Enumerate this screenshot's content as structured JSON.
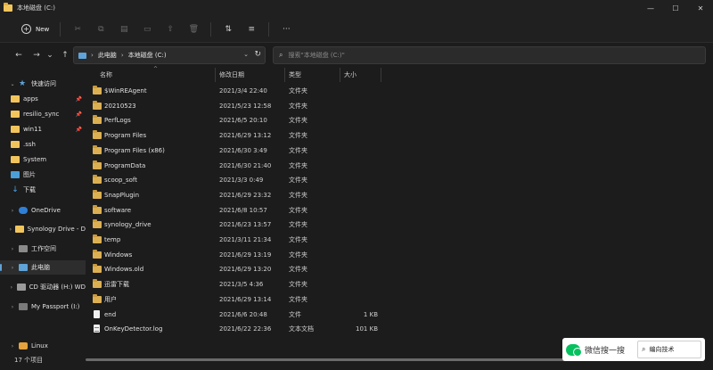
{
  "window": {
    "title": "本地磁盘 (C:)",
    "controls": {
      "minimize": "—",
      "maximize": "☐",
      "close": "✕"
    }
  },
  "toolbar": {
    "new_label": "New",
    "new_icon": "+",
    "icons": [
      {
        "name": "cut-icon",
        "glyph": "✂"
      },
      {
        "name": "copy-icon",
        "glyph": "⧉"
      },
      {
        "name": "paste-icon",
        "glyph": "▤"
      },
      {
        "name": "rename-icon",
        "glyph": "▭"
      },
      {
        "name": "share-icon",
        "glyph": "⇧"
      },
      {
        "name": "delete-icon",
        "glyph": "🗑"
      }
    ],
    "sort_glyph": "⇅",
    "view_glyph": "≡",
    "more_glyph": "···"
  },
  "nav": {
    "back": "←",
    "forward": "→",
    "recent": "⌄",
    "up": "↑"
  },
  "address": {
    "crumbs": [
      "此电脑",
      "本地磁盘 (C:)"
    ],
    "sep": "›",
    "dropdown": "⌄",
    "refresh": "↻"
  },
  "search": {
    "placeholder": "搜索\"本地磁盘 (C:)\"",
    "icon": "⌕"
  },
  "sidebar": {
    "items": [
      {
        "label": "快速访问",
        "icon": "star",
        "arrow": "⌄",
        "indent": false
      },
      {
        "label": "apps",
        "icon": "folder",
        "indent": true,
        "pin": "📌"
      },
      {
        "label": "resilio_sync",
        "icon": "folder",
        "indent": true,
        "pin": "📌"
      },
      {
        "label": "win11",
        "icon": "folder",
        "indent": true,
        "pin": "📌"
      },
      {
        "label": ".ssh",
        "icon": "folder",
        "indent": true
      },
      {
        "label": "System",
        "icon": "folder",
        "indent": true
      },
      {
        "label": "图片",
        "icon": "pic",
        "indent": true
      },
      {
        "label": "下载",
        "icon": "down",
        "indent": true
      },
      {
        "label": "OneDrive",
        "icon": "cloud",
        "arrow": "›",
        "indent": false
      },
      {
        "label": "Synology Drive - D",
        "icon": "syn",
        "arrow": "›",
        "indent": false
      },
      {
        "label": "工作空间",
        "icon": "desk",
        "arrow": "›",
        "indent": false
      },
      {
        "label": "此电脑",
        "icon": "pc",
        "arrow": "›",
        "indent": false,
        "selected": true
      },
      {
        "label": "CD 驱动器 (H:) WD",
        "icon": "cd",
        "arrow": "›",
        "indent": false
      },
      {
        "label": "My Passport (I:)",
        "icon": "drive",
        "arrow": "›",
        "indent": false
      },
      {
        "label": "Linux",
        "icon": "linux",
        "arrow": "›",
        "indent": false
      }
    ]
  },
  "columns": {
    "name": "名称",
    "date": "修改日期",
    "type": "类型",
    "size": "大小",
    "sort_caret": "^"
  },
  "files": [
    {
      "name": "$WinREAgent",
      "date": "2021/3/4 22:40",
      "type": "文件夹",
      "size": "",
      "kind": "folder"
    },
    {
      "name": "20210523",
      "date": "2021/5/23 12:58",
      "type": "文件夹",
      "size": "",
      "kind": "folder"
    },
    {
      "name": "PerfLogs",
      "date": "2021/6/5 20:10",
      "type": "文件夹",
      "size": "",
      "kind": "folder"
    },
    {
      "name": "Program Files",
      "date": "2021/6/29 13:12",
      "type": "文件夹",
      "size": "",
      "kind": "folder"
    },
    {
      "name": "Program Files (x86)",
      "date": "2021/6/30 3:49",
      "type": "文件夹",
      "size": "",
      "kind": "folder"
    },
    {
      "name": "ProgramData",
      "date": "2021/6/30 21:40",
      "type": "文件夹",
      "size": "",
      "kind": "folder"
    },
    {
      "name": "scoop_soft",
      "date": "2021/3/3 0:49",
      "type": "文件夹",
      "size": "",
      "kind": "folder"
    },
    {
      "name": "SnapPlugin",
      "date": "2021/6/29 23:32",
      "type": "文件夹",
      "size": "",
      "kind": "folder"
    },
    {
      "name": "software",
      "date": "2021/6/8 10:57",
      "type": "文件夹",
      "size": "",
      "kind": "folder"
    },
    {
      "name": "synology_drive",
      "date": "2021/6/23 13:57",
      "type": "文件夹",
      "size": "",
      "kind": "folder"
    },
    {
      "name": "temp",
      "date": "2021/3/11 21:34",
      "type": "文件夹",
      "size": "",
      "kind": "folder"
    },
    {
      "name": "Windows",
      "date": "2021/6/29 13:19",
      "type": "文件夹",
      "size": "",
      "kind": "folder"
    },
    {
      "name": "Windows.old",
      "date": "2021/6/29 13:20",
      "type": "文件夹",
      "size": "",
      "kind": "folder"
    },
    {
      "name": "迅雷下载",
      "date": "2021/3/5 4:36",
      "type": "文件夹",
      "size": "",
      "kind": "folder"
    },
    {
      "name": "用户",
      "date": "2021/6/29 13:14",
      "type": "文件夹",
      "size": "",
      "kind": "folder"
    },
    {
      "name": "end",
      "date": "2021/6/6 20:48",
      "type": "文件",
      "size": "1 KB",
      "kind": "file"
    },
    {
      "name": "OnKeyDetector.log",
      "date": "2021/6/22 22:36",
      "type": "文本文档",
      "size": "101 KB",
      "kind": "text"
    }
  ],
  "status": {
    "count": "17 个项目"
  },
  "watermark": {
    "brand": "微信搜一搜",
    "query": "编向技术",
    "search_glyph": "⌕"
  },
  "colors": {
    "accent": "#5fa3d8",
    "folder": "#dcb052",
    "background": "#1c1c1c"
  }
}
